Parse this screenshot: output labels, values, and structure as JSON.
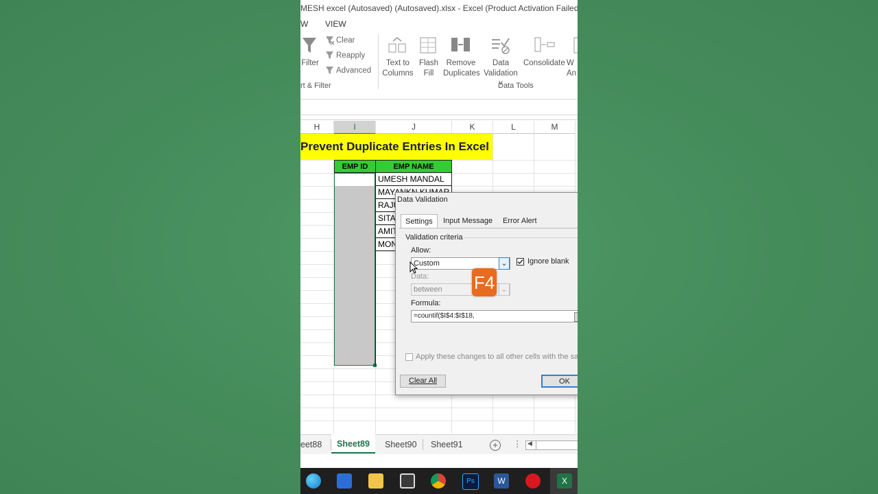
{
  "window": {
    "title": "MESH excel (Autosaved) (Autosaved).xlsx - Excel (Product Activation Failed)"
  },
  "menu": {
    "item_w": "W",
    "item_view": "VIEW"
  },
  "ribbon": {
    "filter": "Filter",
    "clear": "Clear",
    "reapply": "Reapply",
    "advanced": "Advanced",
    "sort_filter_group": "rt & Filter",
    "text_to_columns_1": "Text to",
    "text_to_columns_2": "Columns",
    "flash_fill_1": "Flash",
    "flash_fill_2": "Fill",
    "remove_dup_1": "Remove",
    "remove_dup_2": "Duplicates",
    "data_val_1": "Data",
    "data_val_2": "Validation ˅",
    "consolidate": "Consolidate",
    "whatif_1": "W",
    "whatif_2": "An",
    "data_tools_group": "Data Tools"
  },
  "grid": {
    "columns": [
      "H",
      "I",
      "J",
      "K",
      "L",
      "M"
    ],
    "title": "Prevent Duplicate Entries In Excel",
    "header_id": "EMP ID",
    "header_name": "EMP NAME",
    "names": [
      "UMESH MANDAL",
      "MAYANKN KUMAR",
      "RAJU",
      "SITA",
      "AMIT",
      "MON"
    ]
  },
  "dialog": {
    "title": "Data Validation",
    "tabs": [
      "Settings",
      "Input Message",
      "Error Alert"
    ],
    "section": "Validation criteria",
    "allow_label": "Allow:",
    "allow_value": "Custom",
    "ignore_blank": "Ignore blank",
    "data_label": "Data:",
    "data_value": "between",
    "formula_label": "Formula:",
    "formula_value": "=countif($I$4:$I$18,",
    "apply_all": "Apply these changes to all other cells with the sa",
    "clear_all": "Clear All",
    "ok": "OK"
  },
  "overlay_key": "F4",
  "sheets": [
    "eet88",
    "Sheet89",
    "Sheet90",
    "Sheet91"
  ],
  "colors": {
    "excel_green": "#217346",
    "title_yellow": "#ffff00",
    "header_green": "#33cc33",
    "selection_gray": "#c8c8c8",
    "bg_green": "#458c5b",
    "key_orange": "#e86b1f"
  }
}
